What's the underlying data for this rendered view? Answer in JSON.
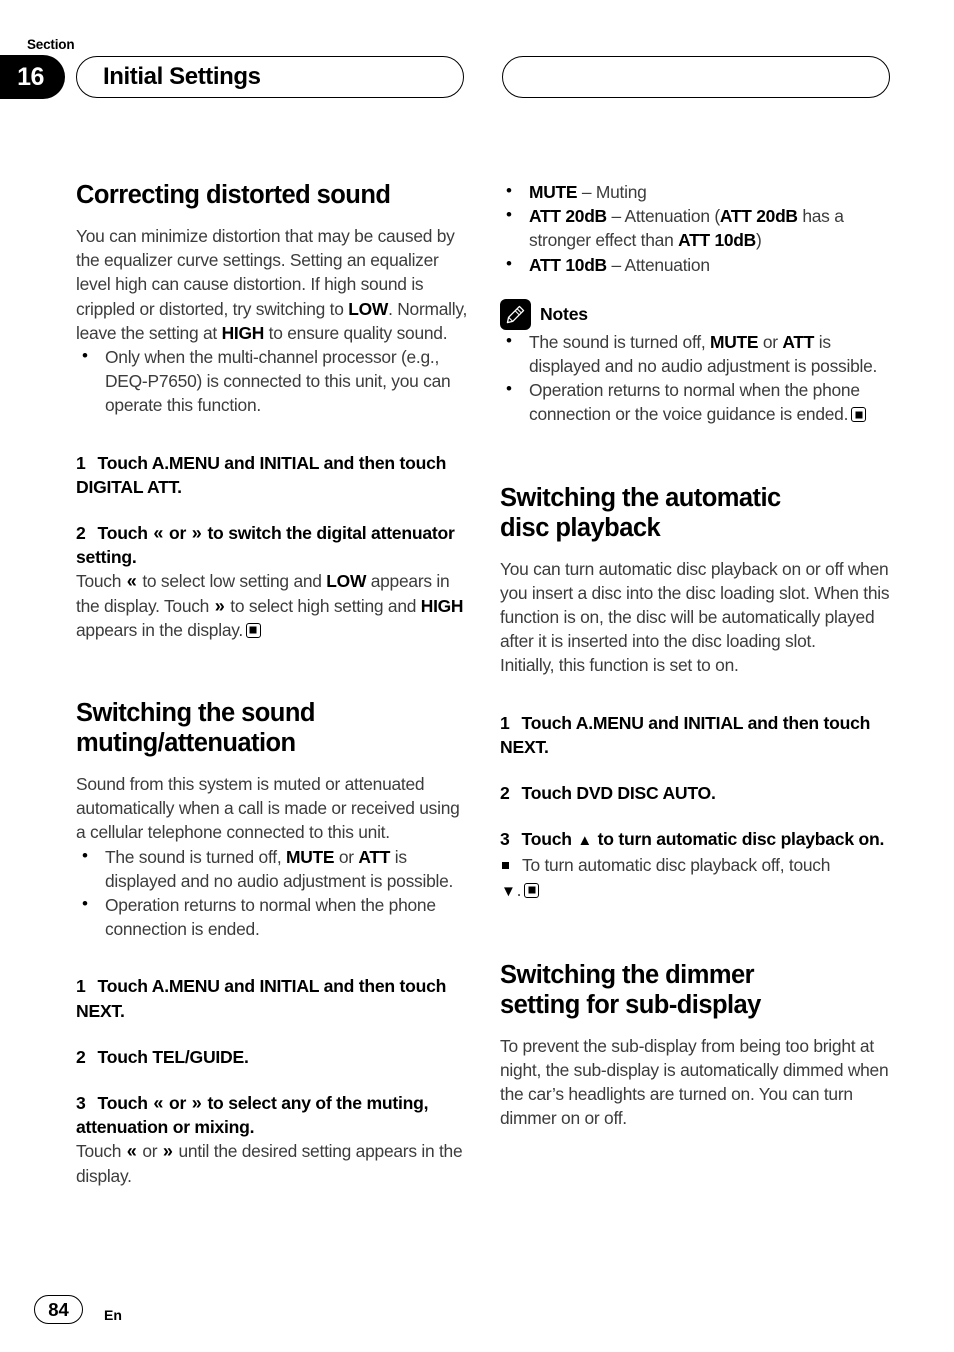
{
  "header": {
    "section_word": "Section",
    "section_number": "16",
    "title": "Initial Settings",
    "right_pill": ""
  },
  "left_column": {
    "heading_1": "Correcting distorted sound",
    "intro_1_a": "You can minimize distortion that may be caused by the equalizer curve settings. Setting an equalizer level high can cause distortion. If high sound is crippled or distorted, try switching to ",
    "intro_1_low": "LOW",
    "intro_1_b": ". Normally, leave the setting at ",
    "intro_1_high": "HIGH",
    "intro_1_c": " to ensure quality sound.",
    "bullet_1": "Only when the multi-channel processor (e.g., DEQ-P7650) is connected to this unit, you can operate this function.",
    "step_1_num": "1",
    "step_1_text": "Touch A.MENU and INITIAL and then touch DIGITAL ATT.",
    "step_2_num": "2",
    "step_2_a": "Touch ",
    "step_2_chev_left": "«",
    "step_2_or": " or ",
    "step_2_chev_right": "»",
    "step_2_b": " to switch the digital attenuator setting.",
    "step_2_body_a": "Touch ",
    "step_2_body_b": " to select low setting and ",
    "step_2_body_low": "LOW",
    "step_2_body_c": " appears in the display. Touch ",
    "step_2_body_d": " to select high setting and ",
    "step_2_body_high": "HIGH",
    "step_2_body_e": " appears in the display.",
    "heading_2_line1": "Switching the sound",
    "heading_2_line2": "muting/attenuation",
    "intro_2": "Sound from this system is muted or attenuated automatically when a call is made or received using a cellular telephone connected to this unit.",
    "bullet_2_a": "The sound is turned off, ",
    "bullet_2_mute": "MUTE",
    "bullet_2_or": " or ",
    "bullet_2_att": "ATT",
    "bullet_2_b": " is displayed and no audio adjustment is possible.",
    "bullet_3": "Operation returns to normal when the phone connection is ended.",
    "step_3_num": "1",
    "step_3_text": "Touch A.MENU and INITIAL and then touch NEXT.",
    "step_4_num": "2",
    "step_4_text": "Touch TEL/GUIDE.",
    "step_5_num": "3",
    "step_5_a": "Touch ",
    "step_5_or": " or ",
    "step_5_b": " to select any of the muting, attenuation or mixing.",
    "step_5_body_a": "Touch ",
    "step_5_body_or": " or ",
    "step_5_body_b": " until the desired setting appears in the display."
  },
  "right_column": {
    "list_mute_term": "MUTE",
    "list_mute_desc": " – Muting",
    "list_att20_term": "ATT 20dB",
    "list_att20_desc_a": " – Attenuation (",
    "list_att20_term2": "ATT 20dB",
    "list_att20_desc_b": " has a stronger effect than ",
    "list_att20_term3": "ATT 10dB",
    "list_att20_desc_c": ")",
    "list_att10_term": "ATT 10dB",
    "list_att10_desc": " – Attenuation",
    "notes_label": "Notes",
    "note_1_a": "The sound is turned off, ",
    "note_1_mute": "MUTE",
    "note_1_or": " or ",
    "note_1_att": "ATT",
    "note_1_b": " is displayed and no audio adjustment is possible.",
    "note_2": "Operation returns to normal when the phone connection or the voice guidance is ended.",
    "heading_3_line1": "Switching the automatic",
    "heading_3_line2": "disc playback",
    "intro_3": "You can turn automatic disc playback on or off when you insert a disc into the disc loading slot. When this function is on, the disc will be automatically played after it is inserted into the disc loading slot.",
    "intro_3b": "Initially, this function is set to on.",
    "step_6_num": "1",
    "step_6_text": "Touch A.MENU and INITIAL and then touch NEXT.",
    "step_7_num": "2",
    "step_7_text": "Touch DVD DISC AUTO.",
    "step_8_num": "3",
    "step_8_a": "Touch ",
    "step_8_up": "▲",
    "step_8_b": " to turn automatic disc playback on.",
    "sub_bullet_a": "To turn automatic disc playback off, touch ",
    "sub_bullet_down": "▼",
    "sub_bullet_b": ".",
    "heading_4_line1": "Switching the dimmer",
    "heading_4_line2": "setting for sub-display",
    "intro_4": "To prevent the sub-display from being too bright at night, the sub-display is automatically dimmed when the car’s headlights are turned on. You can turn dimmer on or off."
  },
  "footer": {
    "page_number": "84",
    "language": "En"
  },
  "colors": {
    "text_body": "#3c3c3c",
    "text_heading": "#000000",
    "badge_bg": "#000000",
    "page_bg": "#ffffff"
  }
}
